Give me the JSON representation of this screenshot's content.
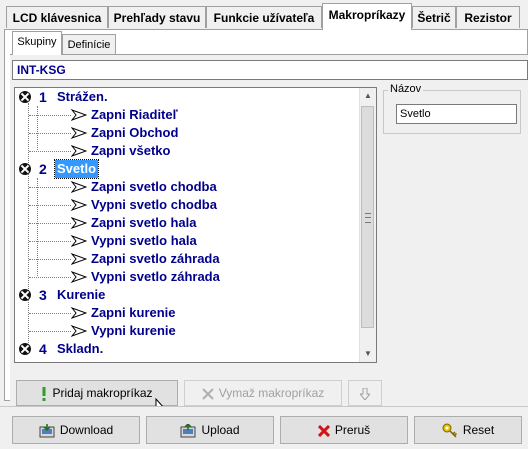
{
  "tabs": [
    {
      "label": "LCD klávesnica",
      "active": false
    },
    {
      "label": "Prehľady stavu",
      "active": false
    },
    {
      "label": "Funkcie užívateľa",
      "active": false
    },
    {
      "label": "Makropríkazy",
      "active": true
    },
    {
      "label": "Šetrič",
      "active": false
    },
    {
      "label": "Rezistor",
      "active": false
    }
  ],
  "subtabs": [
    {
      "label": "Skupiny",
      "active": true
    },
    {
      "label": "Definície",
      "active": false
    }
  ],
  "device": "INT-KSG",
  "tree": {
    "groups": [
      {
        "num": "1",
        "label": "Strážen.",
        "selected": false,
        "items": [
          "Zapni Riaditeľ",
          "Zapni Obchod",
          "Zapni všetko"
        ]
      },
      {
        "num": "2",
        "label": "Svetlo",
        "selected": true,
        "items": [
          "Zapni svetlo chodba",
          "Vypni svetlo chodba",
          "Zapni svetlo hala",
          "Vypni svetlo hala",
          "Zapni svetlo záhrada",
          "Vypni svetlo záhrada"
        ]
      },
      {
        "num": "3",
        "label": "Kurenie",
        "selected": false,
        "items": [
          "Zapni kurenie",
          "Vypni kurenie"
        ]
      },
      {
        "num": "4",
        "label": "Skladn.",
        "selected": false,
        "items": []
      }
    ]
  },
  "name_field": {
    "legend": "Názov",
    "value": "Svetlo"
  },
  "actions": {
    "add": "Pridaj makropríkaz",
    "delete": "Vymaž makropríkaz"
  },
  "bottom": {
    "download": "Download",
    "upload": "Upload",
    "interrupt": "Preruš",
    "reset": "Reset"
  },
  "colors": {
    "tree_text": "#00008b",
    "selection": "#3399ff"
  }
}
